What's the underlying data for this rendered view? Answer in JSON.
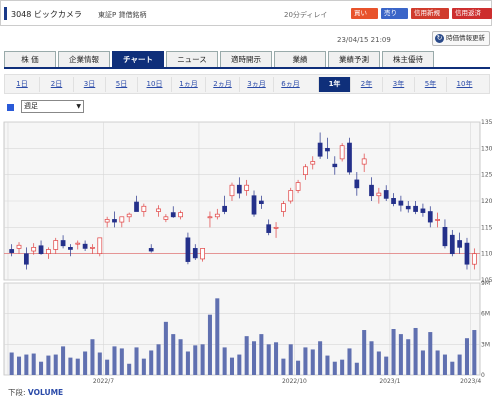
{
  "header": {
    "title": "3048 ビックカメラ",
    "market": "東証P  貸借銘柄",
    "delay": "20分ディレイ",
    "buttons": [
      "買い",
      "売り",
      "信用新規",
      "信用返済"
    ]
  },
  "timestamp": "23/04/15 21:09",
  "toggle_label": "時価情報更新",
  "tabs": [
    "株 価",
    "企業情報",
    "チャート",
    "ニュース",
    "適時開示",
    "業績",
    "業績予測",
    "株主優待"
  ],
  "active_tab": "チャート",
  "periods": [
    "1日",
    "2日",
    "3日",
    "5日",
    "10日",
    "1ヵ月",
    "2ヵ月",
    "3ヵ月",
    "6ヵ月",
    "1年",
    "2年",
    "3年",
    "5年",
    "10年"
  ],
  "active_period": "1年",
  "chart_select": "週足",
  "footer": {
    "label": "下段:",
    "value": "VOLUME"
  },
  "colors": {
    "navy": "#0f2f7a",
    "up": "#e04040",
    "down": "#24308a",
    "volume": "#6070b0",
    "hline": "#e06060"
  },
  "chart_data": [
    {
      "type": "candlestick",
      "y_ticks": [
        "1350",
        "1300",
        "1250",
        "1200",
        "1150",
        "1100",
        "1050"
      ],
      "ylim": [
        1050,
        1350
      ],
      "reference_line": 1100,
      "x_labels": [
        "2022/7",
        "2022/10",
        "2023/1",
        "2023/4"
      ],
      "ohlc": [
        [
          1108,
          1118,
          1095,
          1102
        ],
        [
          1110,
          1122,
          1100,
          1116
        ],
        [
          1100,
          1112,
          1070,
          1080
        ],
        [
          1105,
          1120,
          1098,
          1112
        ],
        [
          1115,
          1125,
          1098,
          1100
        ],
        [
          1100,
          1112,
          1090,
          1108
        ],
        [
          1108,
          1130,
          1100,
          1125
        ],
        [
          1125,
          1135,
          1110,
          1115
        ],
        [
          1112,
          1118,
          1095,
          1108
        ],
        [
          1118,
          1125,
          1108,
          1120
        ],
        [
          1118,
          1125,
          1105,
          1110
        ],
        [
          1110,
          1118,
          1100,
          1112
        ],
        [
          1100,
          1130,
          1095,
          1130
        ],
        [
          1160,
          1170,
          1150,
          1165
        ],
        [
          1165,
          1180,
          1150,
          1160
        ],
        [
          1160,
          1170,
          1150,
          1170
        ],
        [
          1170,
          1178,
          1160,
          1175
        ],
        [
          1198,
          1210,
          1180,
          1180
        ],
        [
          1180,
          1195,
          1170,
          1190
        ],
        [
          1110,
          1118,
          1102,
          1105
        ],
        [
          1180,
          1192,
          1170,
          1185
        ],
        [
          1165,
          1175,
          1160,
          1170
        ],
        [
          1178,
          1190,
          1168,
          1170
        ],
        [
          1170,
          1182,
          1165,
          1178
        ],
        [
          1130,
          1140,
          1080,
          1085
        ],
        [
          1110,
          1118,
          1088,
          1092
        ],
        [
          1090,
          1110,
          1085,
          1110
        ],
        [
          1170,
          1180,
          1150,
          1170
        ],
        [
          1170,
          1185,
          1165,
          1175
        ],
        [
          1190,
          1210,
          1175,
          1180
        ],
        [
          1210,
          1235,
          1200,
          1230
        ],
        [
          1230,
          1245,
          1205,
          1215
        ],
        [
          1220,
          1240,
          1210,
          1230
        ],
        [
          1210,
          1220,
          1170,
          1175
        ],
        [
          1200,
          1210,
          1185,
          1195
        ],
        [
          1155,
          1165,
          1135,
          1140
        ],
        [
          1150,
          1160,
          1130,
          1150
        ],
        [
          1180,
          1200,
          1170,
          1195
        ],
        [
          1200,
          1225,
          1195,
          1220
        ],
        [
          1220,
          1240,
          1215,
          1235
        ],
        [
          1250,
          1270,
          1240,
          1265
        ],
        [
          1270,
          1285,
          1260,
          1275
        ],
        [
          1310,
          1330,
          1280,
          1285
        ],
        [
          1300,
          1320,
          1280,
          1295
        ],
        [
          1270,
          1285,
          1250,
          1265
        ],
        [
          1280,
          1310,
          1275,
          1305
        ],
        [
          1310,
          1320,
          1250,
          1255
        ],
        [
          1240,
          1255,
          1210,
          1225
        ],
        [
          1270,
          1290,
          1255,
          1280
        ],
        [
          1230,
          1245,
          1200,
          1210
        ],
        [
          1210,
          1225,
          1195,
          1215
        ],
        [
          1220,
          1230,
          1200,
          1205
        ],
        [
          1205,
          1215,
          1190,
          1195
        ],
        [
          1200,
          1210,
          1180,
          1192
        ],
        [
          1190,
          1200,
          1178,
          1185
        ],
        [
          1190,
          1200,
          1175,
          1180
        ],
        [
          1185,
          1195,
          1170,
          1178
        ],
        [
          1180,
          1190,
          1150,
          1160
        ],
        [
          1165,
          1178,
          1150,
          1165
        ],
        [
          1150,
          1165,
          1110,
          1115
        ],
        [
          1135,
          1145,
          1095,
          1100
        ],
        [
          1125,
          1140,
          1100,
          1112
        ],
        [
          1120,
          1130,
          1070,
          1080
        ],
        [
          1080,
          1110,
          1070,
          1100
        ]
      ],
      "volume_ticks": [
        "9M",
        "6M",
        "3M",
        "0"
      ],
      "volume": [
        2.2,
        1.8,
        2.0,
        2.1,
        1.3,
        1.9,
        2.0,
        2.8,
        1.7,
        1.6,
        2.3,
        3.5,
        2.2,
        1.5,
        2.8,
        2.6,
        1.1,
        2.7,
        1.6,
        2.4,
        3.0,
        5.2,
        4.0,
        3.5,
        2.3,
        2.9,
        3.0,
        5.9,
        7.5,
        2.7,
        1.7,
        2.0,
        3.8,
        3.3,
        4.0,
        3.0,
        3.2,
        1.6,
        3.0,
        1.4,
        2.7,
        2.5,
        3.3,
        1.9,
        1.3,
        1.5,
        2.6,
        1.2,
        4.4,
        3.3,
        2.3,
        1.8,
        4.5,
        4.0,
        3.5,
        4.6,
        2.4,
        4.2,
        2.4,
        2.0,
        1.3,
        2.0,
        3.6,
        4.4
      ]
    }
  ]
}
